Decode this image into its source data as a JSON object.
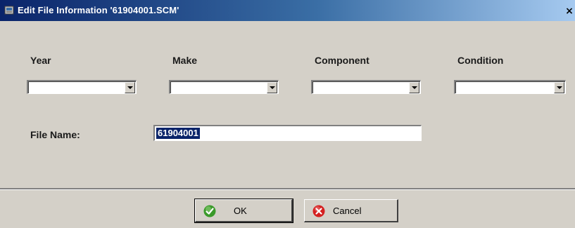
{
  "window": {
    "title": "Edit File Information '61904001.SCM'",
    "close_glyph": "×"
  },
  "fields": {
    "year": {
      "label": "Year",
      "value": ""
    },
    "make": {
      "label": "Make",
      "value": ""
    },
    "component": {
      "label": "Component",
      "value": ""
    },
    "condition": {
      "label": "Condition",
      "value": ""
    }
  },
  "file_name": {
    "label": "File Name:",
    "value": "61904001"
  },
  "buttons": {
    "ok": {
      "label": "OK",
      "icon": "check-icon"
    },
    "cancel": {
      "label": "Cancel",
      "icon": "cancel-x-icon"
    }
  },
  "colors": {
    "titlebar_start": "#0a246a",
    "titlebar_end": "#a6caf0",
    "dialog_bg": "#d4d0c8",
    "selection": "#0a246a",
    "ok_green": "#3a9a2a",
    "cancel_red": "#d42020"
  }
}
